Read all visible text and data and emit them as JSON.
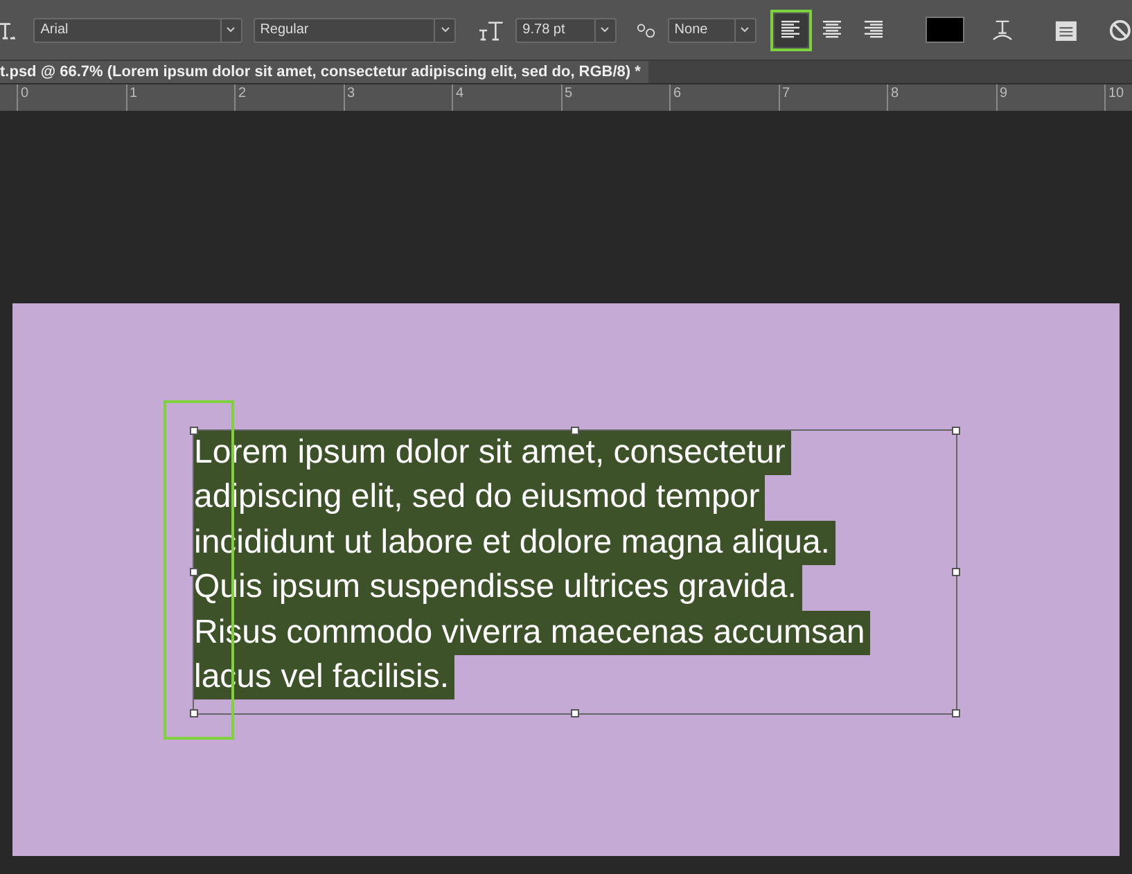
{
  "toolbar": {
    "font_family": "Arial",
    "font_style": "Regular",
    "font_size": "9.78 pt",
    "antialias": "None",
    "alignments": [
      {
        "kind": "left",
        "selected": true
      },
      {
        "kind": "center",
        "selected": false
      },
      {
        "kind": "right",
        "selected": false
      }
    ],
    "color": "#000000"
  },
  "document_tab": {
    "title": "t.psd @ 66.7% (Lorem ipsum dolor sit amet, consectetur adipiscing elit, sed do, RGB/8) *"
  },
  "ruler": {
    "ticks": [
      "0",
      "1",
      "2",
      "3",
      "4",
      "5",
      "6",
      "7",
      "8",
      "9",
      "10"
    ]
  },
  "canvas": {
    "text_lines": [
      "Lorem ipsum dolor sit amet, consectetur",
      "adipiscing elit, sed do eiusmod tempor",
      "incididunt ut labore et dolore magna aliqua.",
      "Quis ipsum suspendisse ultrices gravida.",
      "Risus commodo viverra maecenas accumsan",
      "lacus vel facilisis."
    ]
  }
}
